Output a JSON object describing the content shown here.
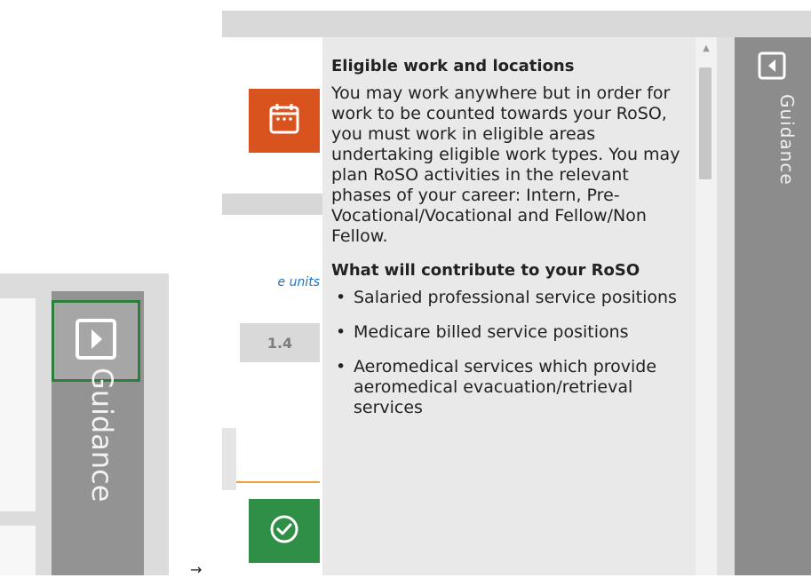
{
  "main": {
    "units_link": "e units",
    "value_chip": "1.4"
  },
  "guidance": {
    "heading_1": "Eligible work and locations",
    "paragraph_1": "You may work anywhere but in order for work to be counted towards your RoSO, you must work in eligible areas undertaking eligible work types. You may plan RoSO activities in the relevant phases of your career: Intern, Pre-Vocational/Vocational and Fellow/Non Fellow.",
    "heading_2": "What will contribute to your RoSO",
    "bullets": [
      "Salaried professional service positions",
      "Medicare billed service positions",
      "Aeromedical services which provide aeromedical evacuation/retrieval services"
    ],
    "rail_label": "Guidance"
  },
  "collapsed_guidance": {
    "label": "Guidance"
  },
  "arrow": {
    "symbol": "→"
  },
  "colors": {
    "calendar_tile": "#d9531e",
    "check_tile": "#2f8f46",
    "highlight_border": "#2b7f3b",
    "rail_gray": "#8c8c8c",
    "link_blue": "#1a73c9"
  },
  "icons": [
    "calendar-icon",
    "check-circle-icon",
    "panel-toggle-left-icon",
    "panel-toggle-right-icon",
    "scroll-up-arrow-icon"
  ]
}
